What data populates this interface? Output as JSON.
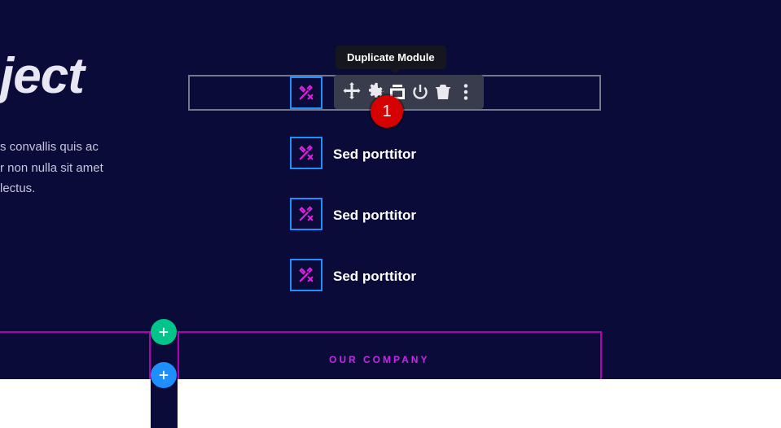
{
  "heading": "ject",
  "paragraph": "s convallis quis ac\nr non nulla sit amet\n lectus.",
  "tooltip": "Duplicate Module",
  "annotation": "1",
  "blurbs": [
    {
      "label": ""
    },
    {
      "label": "Sed porttitor"
    },
    {
      "label": "Sed porttitor"
    },
    {
      "label": "Sed porttitor"
    }
  ],
  "our_company": "OUR COMPANY",
  "colors": {
    "magenta": "#e020e0",
    "border_blue": "#1f8fff",
    "border_gray": "#74788b",
    "fab_green": "#00c48a",
    "fab_blue": "#1f8fff",
    "red": "#d50000",
    "purple": "#b300b3"
  }
}
